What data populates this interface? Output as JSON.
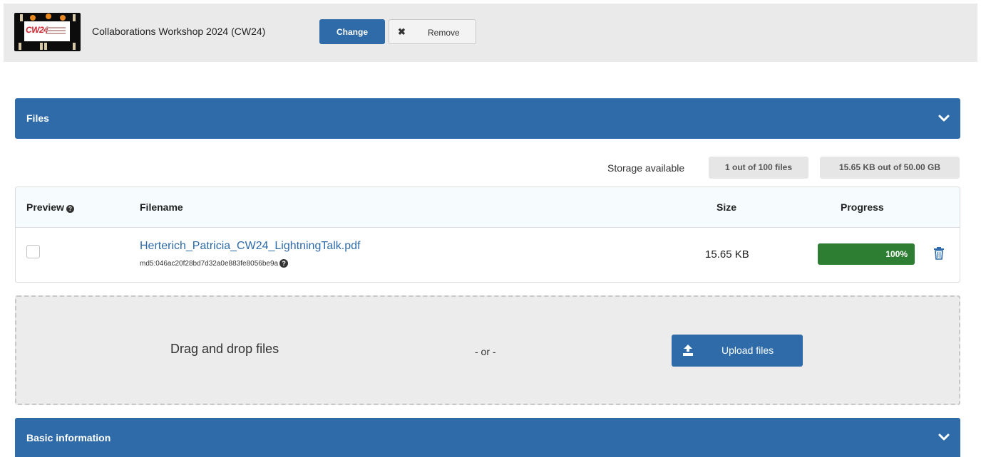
{
  "community": {
    "logo_text": "CW24",
    "title": "Collaborations Workshop 2024 (CW24)",
    "change_label": "Change",
    "remove_label": "Remove"
  },
  "files_section": {
    "title": "Files",
    "storage_label": "Storage available",
    "files_count_badge": "1 out of 100 files",
    "storage_size_badge": "15.65 KB out of 50.00 GB",
    "columns": [
      "Preview",
      "Filename",
      "Size",
      "Progress"
    ],
    "rows": [
      {
        "filename": "Herterich_Patricia_CW24_LightningTalk.pdf",
        "checksum": "md5:046ac20f28bd7d32a0e883fe8056be9a",
        "size": "15.65 KB",
        "progress_label": "100%",
        "progress_fraction": 1.0,
        "preview_checked": false
      }
    ]
  },
  "dropzone": {
    "drag_text": "Drag and drop files",
    "or_text": "- or -",
    "upload_label": "Upload files"
  },
  "basic_section": {
    "title": "Basic information"
  },
  "colors": {
    "primary": "#2f6ba8",
    "success": "#2d7d32",
    "header_bg": "#eaeaea",
    "dropzone_bg": "#ececec"
  },
  "icons": {
    "help": "question-circle-icon",
    "chevron": "chevron-down-icon",
    "delete": "trash-icon",
    "upload": "upload-icon",
    "remove": "close-icon"
  }
}
